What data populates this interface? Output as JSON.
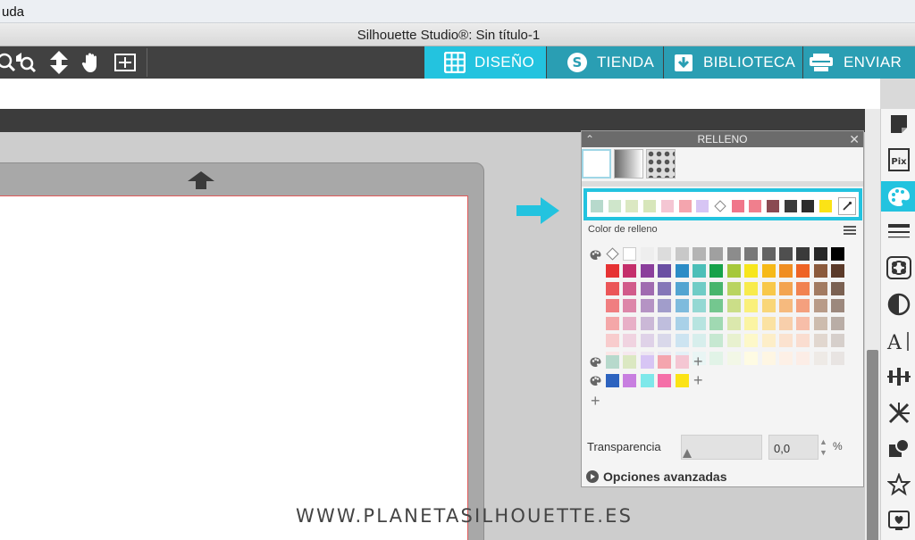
{
  "menubar": {
    "help_label": "uda"
  },
  "window": {
    "title": "Silhouette Studio®: Sin título-1"
  },
  "nav_tabs": [
    {
      "label": "DISEÑO",
      "icon": "grid-icon",
      "active": true
    },
    {
      "label": "TIENDA",
      "icon": "store-s-icon",
      "active": false
    },
    {
      "label": "BIBLIOTECA",
      "icon": "library-download-icon",
      "active": false
    },
    {
      "label": "ENVIAR",
      "icon": "send-cutter-icon",
      "active": false
    }
  ],
  "toolbar_icons": [
    "zoom-icon",
    "zoom-fit-icon",
    "move-arrows-icon",
    "pan-hand-icon",
    "fit-page-icon"
  ],
  "fill_panel": {
    "title": "RELLENO",
    "fill_types": [
      "solid-fill",
      "gradient-fill",
      "pattern-fill"
    ],
    "recent_colors": [
      "#b7d9cc",
      "#cfe6cb",
      "#dbe8c2",
      "#d7e6ba",
      "#f4c6d3",
      "#f4a5ae",
      "#d7c5f4",
      "transparent",
      "#f0768a",
      "#f07f8d",
      "#8a4a52",
      "#3b3b3b",
      "#2d2d2d",
      "#fbe316"
    ],
    "eyedropper": "eyedropper-icon",
    "section_label": "Color de relleno",
    "top_row": [
      "transparent",
      "#ffffff",
      "#eeeeee",
      "#dcdcdc",
      "#c8c8c8",
      "#b4b4b4",
      "#a0a0a0",
      "#8c8c8c",
      "#787878",
      "#636363",
      "#4f4f4f",
      "#3a3a3a",
      "#262626",
      "#000000"
    ],
    "palette": [
      [
        "#e63233",
        "#c42f6b",
        "#8b3f9c",
        "#6a4fa3",
        "#2b8cc6",
        "#4cbfb8",
        "#17a24a",
        "#a6c83a",
        "#f7e61d",
        "#f6b918",
        "#f08e22",
        "#ee6324",
        "#8b5a3c",
        "#5b3a29"
      ],
      [
        "#eb5557",
        "#d15b8a",
        "#a06bb0",
        "#8577b8",
        "#52a4d1",
        "#70ccc6",
        "#47b56c",
        "#b9d461",
        "#f8eb4c",
        "#f8c84a",
        "#f3a451",
        "#f18250",
        "#a27b62",
        "#7b6152"
      ],
      [
        "#f07e80",
        "#dd86a9",
        "#b593c4",
        "#a19dcb",
        "#7ebbdd",
        "#94d8d3",
        "#74c78f",
        "#cbde88",
        "#faf07a",
        "#f9d678",
        "#f6ba7e",
        "#f4a07e",
        "#b89b88",
        "#9c887d"
      ],
      [
        "#f4a7a8",
        "#e8afc7",
        "#cbb8d7",
        "#bfbedd",
        "#a9d1e8",
        "#b7e4e0",
        "#a0d9b2",
        "#dbe8ad",
        "#fbf4a3",
        "#fbe2a2",
        "#f8cfab",
        "#f7bea9",
        "#cdbcae",
        "#b9ada6"
      ],
      [
        "#f8cccd",
        "#f0d3e0",
        "#dfd2e8",
        "#d9d8ea",
        "#cde4f1",
        "#d7eeec",
        "#c6e8d1",
        "#e8f1cf",
        "#fdf8c9",
        "#fdeec8",
        "#fbe2cf",
        "#faddd0",
        "#e1d7cf",
        "#d6cfcb"
      ],
      [
        "#fbe6e6",
        "#f6e8ef",
        "#ede6f2",
        "#eaeaf4",
        "#e4f0f7",
        "#e9f5f4",
        "#e1f3e7",
        "#f2f7e6",
        "#fefbe3",
        "#fef6e3",
        "#fdf0e6",
        "#fcede6",
        "#eeeae6",
        "#e8e4e2"
      ]
    ],
    "custom_row_1": [
      "#b7d9cc",
      "#dbe8c2",
      "#d7c5f4",
      "#f4a5ae",
      "#f4c6d3"
    ],
    "custom_row_2": [
      "#2d63bf",
      "#c87ee0",
      "#7ee8ea",
      "#f56fa8",
      "#fbe316"
    ],
    "transparency_label": "Transparencia",
    "transparency_value": "0,0",
    "transparency_fraction": 0,
    "percent_sign": "%",
    "advanced_label": "Opciones avanzadas"
  },
  "right_sidebar_icons": [
    "page-setup-icon",
    "pixscan-icon",
    "fill-palette-icon",
    "line-style-icon",
    "trace-icon",
    "offset-icon",
    "text-icon",
    "align-icon",
    "replicate-icon",
    "modify-icon",
    "library-star-icon",
    "design-store-icon"
  ],
  "colors": {
    "accent": "#23c3df",
    "tab_inactive": "#2a9eb3",
    "toolbar": "#414141"
  },
  "watermark": "WWW.PLANETASILHOUETTE.ES"
}
